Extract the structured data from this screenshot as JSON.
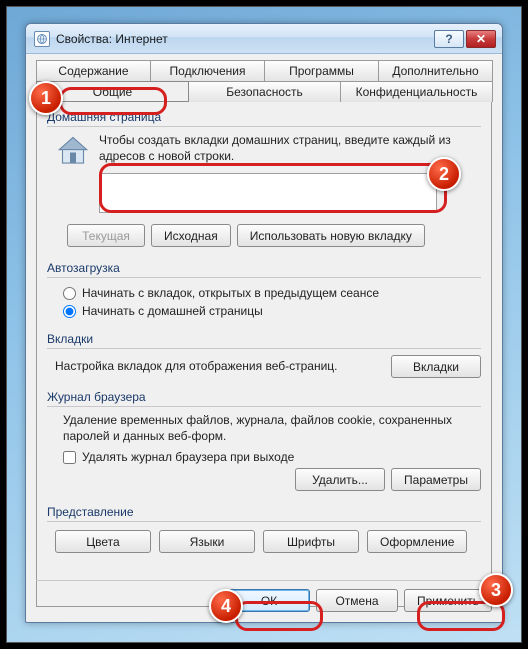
{
  "window": {
    "title": "Свойства: Интернет"
  },
  "tabs_row1": [
    "Содержание",
    "Подключения",
    "Программы",
    "Дополнительно"
  ],
  "tabs_row2": [
    "Общие",
    "Безопасность",
    "Конфиденциальность"
  ],
  "homepage": {
    "group": "Домашняя страница",
    "hint": "Чтобы создать вкладки домашних страниц, введите каждый из адресов с новой строки.",
    "value": "",
    "btn_current": "Текущая",
    "btn_default": "Исходная",
    "btn_newtab": "Использовать новую вкладку"
  },
  "autoload": {
    "group": "Автозагрузка",
    "opt_last": "Начинать с вкладок, открытых в предыдущем сеансе",
    "opt_home": "Начинать с домашней страницы"
  },
  "tabs_section": {
    "group": "Вкладки",
    "desc": "Настройка вкладок для отображения веб-страниц.",
    "btn": "Вкладки"
  },
  "history": {
    "group": "Журнал браузера",
    "desc": "Удаление временных файлов, журнала, файлов cookie, сохраненных паролей и данных веб-форм.",
    "chk": "Удалять журнал браузера при выходе",
    "btn_delete": "Удалить...",
    "btn_params": "Параметры"
  },
  "appearance": {
    "group": "Представление",
    "btn_colors": "Цвета",
    "btn_langs": "Языки",
    "btn_fonts": "Шрифты",
    "btn_format": "Оформление"
  },
  "footer": {
    "ok": "ОК",
    "cancel": "Отмена",
    "apply": "Применить"
  },
  "callouts": {
    "1": "1",
    "2": "2",
    "3": "3",
    "4": "4"
  }
}
